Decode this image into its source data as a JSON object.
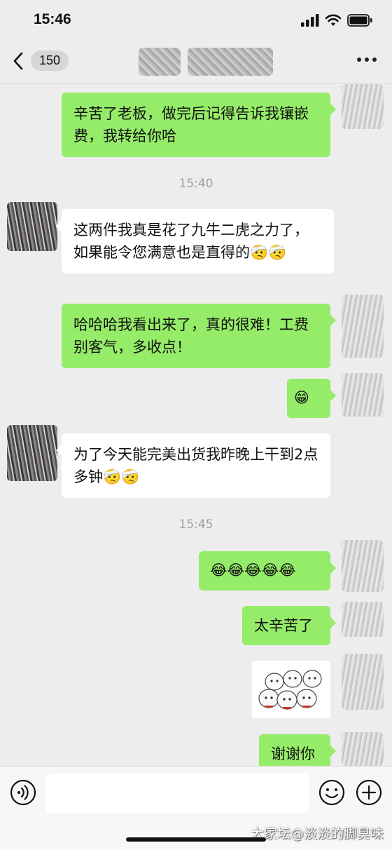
{
  "status_bar": {
    "time": "15:46"
  },
  "nav": {
    "unread_count": "150"
  },
  "messages": [
    {
      "text": "辛苦了老板，做完后记得告诉我镶嵌费，我转给你哈"
    },
    {
      "timestamp": "15:40"
    },
    {
      "text": "这两件我真是花了九牛二虎之力了，如果能令您满意也是直得的🤕🤕"
    },
    {
      "text": "哈哈哈我看出来了，真的很难！工费别客气，多收点！"
    },
    {
      "text": "😁"
    },
    {
      "text": "为了今天能完美出货我昨晚上干到2点多钟🤕🤕"
    },
    {
      "timestamp": "15:45"
    },
    {
      "text": "😂😂😂😂😂"
    },
    {
      "text": "太辛苦了"
    },
    {
      "text": "谢谢你"
    }
  ],
  "watermark": "大家坛@淡淡的脚臭味",
  "colors": {
    "outgoing_bubble": "#95ec69",
    "incoming_bubble": "#ffffff",
    "background": "#ededed"
  }
}
